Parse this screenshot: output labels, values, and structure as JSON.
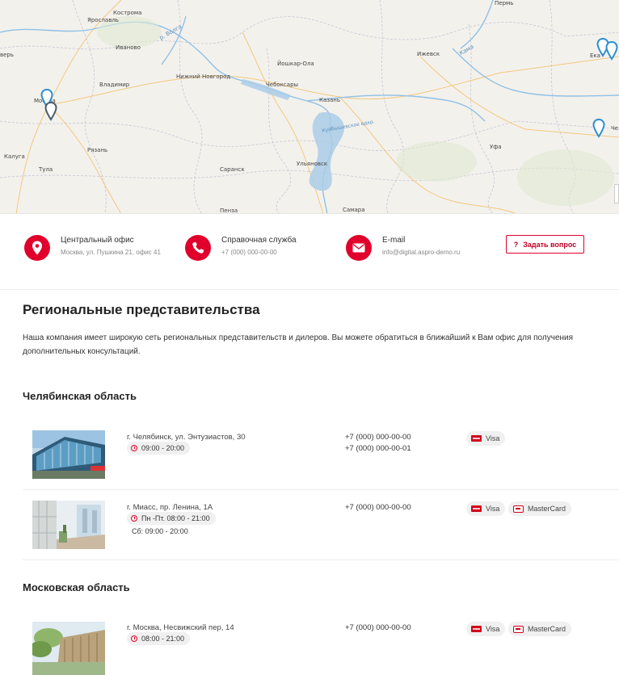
{
  "map": {
    "cities": [
      {
        "name": "Кострома"
      },
      {
        "name": "Ярославль"
      },
      {
        "name": "Иваново"
      },
      {
        "name": "Владимир"
      },
      {
        "name": "Нижний Новгород"
      },
      {
        "name": "Йошкар-Ола"
      },
      {
        "name": "Чебоксары"
      },
      {
        "name": "Ижевск"
      },
      {
        "name": "Пермь"
      },
      {
        "name": "Казань"
      },
      {
        "name": "Москва"
      },
      {
        "name": "Рязань"
      },
      {
        "name": "Калуга"
      },
      {
        "name": "Тула"
      },
      {
        "name": "Саранск"
      },
      {
        "name": "Ульяновск"
      },
      {
        "name": "Уфа"
      },
      {
        "name": "Пенза"
      },
      {
        "name": "Самара"
      },
      {
        "name": "Ека"
      },
      {
        "name": "Че"
      },
      {
        "name": "верь"
      },
      {
        "name": "р. Волга"
      },
      {
        "name": "Кама"
      },
      {
        "name": "Куйбышевское вдхр."
      }
    ],
    "marker_color": "#2a8fd4"
  },
  "contacts": {
    "office": {
      "title": "Центральный офис",
      "sub": "Москва, ул. Пушкина 21, офис 41",
      "icon": "map-pin-icon"
    },
    "support": {
      "title": "Справочная служба",
      "sub": "+7 (000) 000-00-00",
      "icon": "phone-icon"
    },
    "email": {
      "title": "E-mail",
      "sub": "info@digital.aspro-demo.ru",
      "icon": "envelope-icon"
    },
    "ask_button": {
      "icon": "?",
      "label": "Задать вопрос"
    }
  },
  "page": {
    "title": "Региональные представительства",
    "intro": "Наша компания имеет широкую сеть региональных представительств и дилеров. Вы можете обратиться в ближайший к Вам офис для получения дополнительных консультаций."
  },
  "regions": [
    {
      "name": "Челябинская область",
      "offices": [
        {
          "address": "г. Челябинск, ул. Энтузиастов, 30",
          "hours": "09:00 - 20:00",
          "hours2": "",
          "phones": [
            "+7 (000) 000-00-00",
            "+7 (000) 000-00-01"
          ],
          "payments": [
            "Visa"
          ]
        },
        {
          "address": "г. Миасс, пр. Ленина, 1А",
          "hours": "Пн -Пт. 08:00 - 21:00",
          "hours2": "Сб: 09:00 - 20:00",
          "phones": [
            "+7 (000) 000-00-00"
          ],
          "payments": [
            "Visa",
            "MasterCard"
          ]
        }
      ]
    },
    {
      "name": "Московская область",
      "offices": [
        {
          "address": "г. Москва, Несвижский пер, 14",
          "hours": "08:00 - 21:00",
          "hours2": "",
          "phones": [
            "+7 (000) 000-00-00"
          ],
          "payments": [
            "Visa",
            "MasterCard"
          ]
        }
      ]
    }
  ],
  "colors": {
    "accent": "#e0002b",
    "chip": "#f0f0f0",
    "water": "#a9cde8",
    "map_bg": "#f3f1ec"
  }
}
